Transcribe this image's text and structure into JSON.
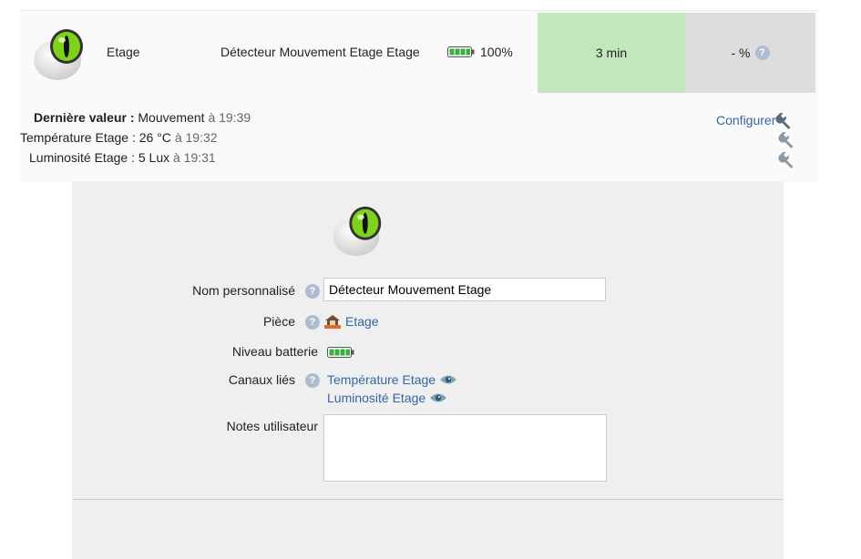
{
  "device": {
    "room": "Etage",
    "name": "Détecteur Mouvement Etage Etage",
    "battery_pct": "100%",
    "battery_level": 1.0,
    "last_seen": "3 min",
    "signal": "- %"
  },
  "values": {
    "last_label": "Dernière valeur :",
    "last_value": "Mouvement",
    "last_time": "à 19:39",
    "temp_label": "Température Etage :",
    "temp_value": "26 °C",
    "temp_time": "à 19:32",
    "lum_label": "Luminosité Etage :",
    "lum_value": "5 Lux",
    "lum_time": "à 19:31"
  },
  "configure_label": "Configurer",
  "form": {
    "name_label": "Nom personnalisé",
    "name_value": "Détecteur Mouvement Etage",
    "room_label": "Pièce",
    "room_value": "Etage",
    "battery_label": "Niveau batterie",
    "channels_label": "Canaux liés",
    "channels": [
      "Température Etage",
      "Luminosité Etage"
    ],
    "notes_label": "Notes utilisateur",
    "notes_value": ""
  },
  "colors": {
    "accent_link": "#3765a2",
    "time_ok": "#c3e6bd",
    "neutral_cell": "#dddddd",
    "battery_green": "#3fae3f"
  }
}
